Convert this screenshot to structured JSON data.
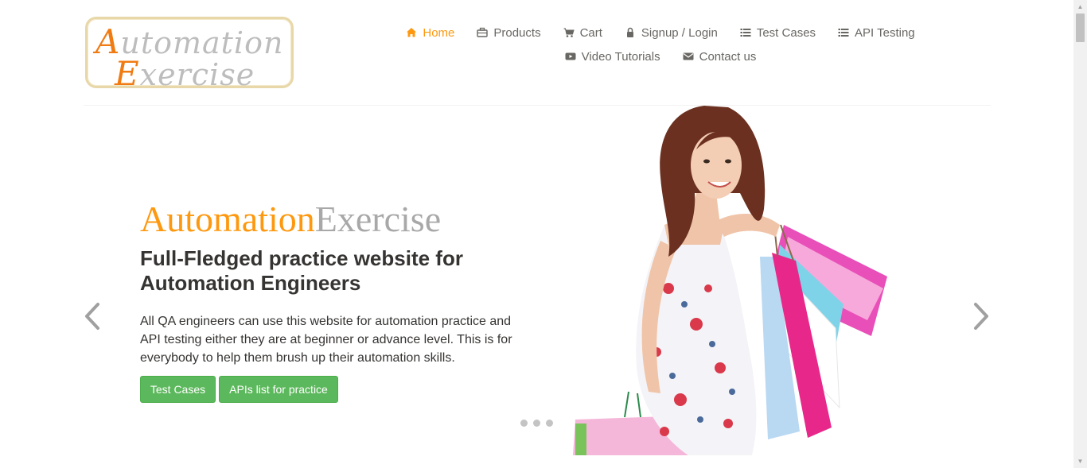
{
  "logo": {
    "line1_cap": "A",
    "line1_rest": "utomation",
    "line2_cap": "E",
    "line2_rest": "xercise"
  },
  "nav": {
    "items": [
      {
        "label": "Home",
        "icon": "home-icon",
        "active": true
      },
      {
        "label": "Products",
        "icon": "products-icon"
      },
      {
        "label": "Cart",
        "icon": "cart-icon"
      },
      {
        "label": "Signup / Login",
        "icon": "lock-icon"
      },
      {
        "label": "Test Cases",
        "icon": "list-icon"
      },
      {
        "label": "API Testing",
        "icon": "list-icon"
      },
      {
        "label": "Video Tutorials",
        "icon": "youtube-icon"
      },
      {
        "label": "Contact us",
        "icon": "envelope-icon"
      }
    ]
  },
  "hero": {
    "brand_a": "Automation",
    "brand_b": "Exercise",
    "headline": "Full-Fledged practice website for Automation Engineers",
    "description": "All QA engineers can use this website for automation practice and API testing either they are at beginner or advance level. This is for everybody to help them brush up their automation skills.",
    "btn_test_cases": "Test Cases",
    "btn_apis": "APIs list for practice",
    "slides": 3
  },
  "colors": {
    "accent": "#fe980f",
    "button": "#5cb85c",
    "text": "#696763",
    "heading": "#363432"
  }
}
